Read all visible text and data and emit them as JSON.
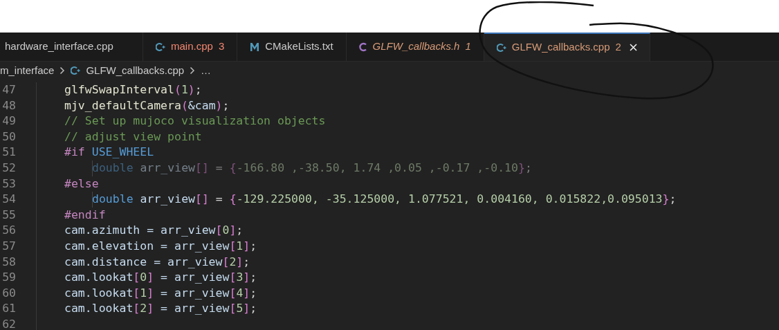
{
  "tabs": [
    {
      "label": "hardware_interface.cpp",
      "kind": "plain",
      "color": "#cccccc",
      "italic": false,
      "selected": false
    },
    {
      "label": "main.cpp",
      "kind": "cpp",
      "badge": "3",
      "color": "#f48771",
      "italic": false,
      "selected": false
    },
    {
      "label": "CMakeLists.txt",
      "kind": "cmake",
      "color": "#cccccc",
      "italic": false,
      "selected": false
    },
    {
      "label": "GLFW_callbacks.h",
      "kind": "c",
      "badge": "1",
      "color": "#d89b78",
      "italic": true,
      "selected": false
    },
    {
      "label": "GLFW_callbacks.cpp",
      "kind": "cpp",
      "badge": "2",
      "color": "#d89b78",
      "italic": false,
      "selected": true
    }
  ],
  "breadcrumb": [
    {
      "label": "m_interface",
      "kind": "folder"
    },
    {
      "label": "GLFW_callbacks.cpp",
      "kind": "cpp"
    },
    {
      "label": "…",
      "kind": "more"
    }
  ],
  "lines": [
    {
      "number": "47",
      "dimmed": false,
      "nested": false,
      "tokens": [
        {
          "text": "glfwSwapInterval",
          "kind": "func"
        },
        {
          "text": "(",
          "kind": "bracket"
        },
        {
          "text": "1",
          "kind": "number"
        },
        {
          "text": ")",
          "kind": "bracket"
        },
        {
          "text": ";",
          "kind": "plain"
        }
      ]
    },
    {
      "number": "48",
      "dimmed": false,
      "nested": false,
      "tokens": [
        {
          "text": "mjv_defaultCamera",
          "kind": "func"
        },
        {
          "text": "(",
          "kind": "bracket"
        },
        {
          "text": "&cam",
          "kind": "var"
        },
        {
          "text": ")",
          "kind": "bracket"
        },
        {
          "text": ";",
          "kind": "plain"
        }
      ]
    },
    {
      "number": "49",
      "dimmed": false,
      "nested": false,
      "tokens": [
        {
          "text": "// Set up mujoco visualization objects",
          "kind": "comment"
        }
      ]
    },
    {
      "number": "50",
      "dimmed": false,
      "nested": false,
      "tokens": [
        {
          "text": "// adjust view point",
          "kind": "comment"
        }
      ]
    },
    {
      "number": "51",
      "dimmed": false,
      "nested": false,
      "tokens": [
        {
          "text": "#if ",
          "kind": "directive"
        },
        {
          "text": "USE_WHEEL",
          "kind": "macro"
        }
      ]
    },
    {
      "number": "52",
      "dimmed": true,
      "nested": true,
      "tokens": [
        {
          "text": "double",
          "kind": "keyword"
        },
        {
          "text": " arr_view",
          "kind": "var"
        },
        {
          "text": "[]",
          "kind": "bracket"
        },
        {
          "text": " = ",
          "kind": "plain"
        },
        {
          "text": "{",
          "kind": "bracket"
        },
        {
          "text": "-166.80 ,-38.50, 1.74 ,0.05 ,-0.17 ,-0.10",
          "kind": "number"
        },
        {
          "text": "}",
          "kind": "bracket"
        },
        {
          "text": ";",
          "kind": "plain"
        }
      ]
    },
    {
      "number": "53",
      "dimmed": false,
      "nested": false,
      "tokens": [
        {
          "text": "#else",
          "kind": "directive"
        }
      ]
    },
    {
      "number": "54",
      "dimmed": false,
      "nested": true,
      "tokens": [
        {
          "text": "double",
          "kind": "keyword"
        },
        {
          "text": " arr_view",
          "kind": "var"
        },
        {
          "text": "[]",
          "kind": "bracket"
        },
        {
          "text": " = ",
          "kind": "plain"
        },
        {
          "text": "{",
          "kind": "bracket"
        },
        {
          "text": "-129.225000, -35.125000, 1.077521, 0.004160, 0.015822,0.095013",
          "kind": "number"
        },
        {
          "text": "}",
          "kind": "bracket"
        },
        {
          "text": ";",
          "kind": "plain"
        }
      ]
    },
    {
      "number": "55",
      "dimmed": false,
      "nested": false,
      "tokens": [
        {
          "text": "#endif",
          "kind": "directive"
        }
      ]
    },
    {
      "number": "56",
      "dimmed": false,
      "nested": false,
      "tokens": [
        {
          "text": "cam.azimuth = arr_view",
          "kind": "var"
        },
        {
          "text": "[",
          "kind": "bracket"
        },
        {
          "text": "0",
          "kind": "number"
        },
        {
          "text": "]",
          "kind": "bracket"
        },
        {
          "text": ";",
          "kind": "plain"
        }
      ]
    },
    {
      "number": "57",
      "dimmed": false,
      "nested": false,
      "tokens": [
        {
          "text": "cam.elevation = arr_view",
          "kind": "var"
        },
        {
          "text": "[",
          "kind": "bracket"
        },
        {
          "text": "1",
          "kind": "number"
        },
        {
          "text": "]",
          "kind": "bracket"
        },
        {
          "text": ";",
          "kind": "plain"
        }
      ]
    },
    {
      "number": "58",
      "dimmed": false,
      "nested": false,
      "tokens": [
        {
          "text": "cam.distance = arr_view",
          "kind": "var"
        },
        {
          "text": "[",
          "kind": "bracket"
        },
        {
          "text": "2",
          "kind": "number"
        },
        {
          "text": "]",
          "kind": "bracket"
        },
        {
          "text": ";",
          "kind": "plain"
        }
      ]
    },
    {
      "number": "59",
      "dimmed": false,
      "nested": false,
      "tokens": [
        {
          "text": "cam.lookat",
          "kind": "var"
        },
        {
          "text": "[",
          "kind": "bracket"
        },
        {
          "text": "0",
          "kind": "number"
        },
        {
          "text": "]",
          "kind": "bracket"
        },
        {
          "text": " = arr_view",
          "kind": "var"
        },
        {
          "text": "[",
          "kind": "bracket"
        },
        {
          "text": "3",
          "kind": "number"
        },
        {
          "text": "]",
          "kind": "bracket"
        },
        {
          "text": ";",
          "kind": "plain"
        }
      ]
    },
    {
      "number": "60",
      "dimmed": false,
      "nested": false,
      "tokens": [
        {
          "text": "cam.lookat",
          "kind": "var"
        },
        {
          "text": "[",
          "kind": "bracket"
        },
        {
          "text": "1",
          "kind": "number"
        },
        {
          "text": "]",
          "kind": "bracket"
        },
        {
          "text": " = arr_view",
          "kind": "var"
        },
        {
          "text": "[",
          "kind": "bracket"
        },
        {
          "text": "4",
          "kind": "number"
        },
        {
          "text": "]",
          "kind": "bracket"
        },
        {
          "text": ";",
          "kind": "plain"
        }
      ]
    },
    {
      "number": "61",
      "dimmed": false,
      "nested": false,
      "tokens": [
        {
          "text": "cam.lookat",
          "kind": "var"
        },
        {
          "text": "[",
          "kind": "bracket"
        },
        {
          "text": "2",
          "kind": "number"
        },
        {
          "text": "]",
          "kind": "bracket"
        },
        {
          "text": " = arr_view",
          "kind": "var"
        },
        {
          "text": "[",
          "kind": "bracket"
        },
        {
          "text": "5",
          "kind": "number"
        },
        {
          "text": "]",
          "kind": "bracket"
        },
        {
          "text": ";",
          "kind": "plain"
        }
      ]
    },
    {
      "number": "62"
    }
  ]
}
